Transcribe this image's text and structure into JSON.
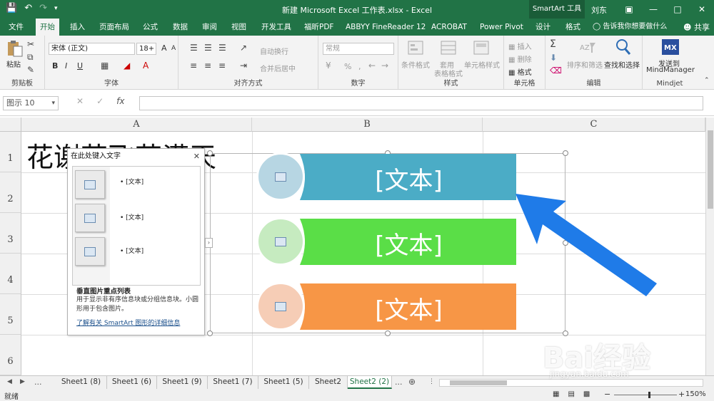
{
  "titlebar": {
    "title": "新建 Microsoft Excel 工作表.xlsx  -  Excel",
    "context_tab": "SmartArt 工具",
    "user": "刘东",
    "qat": [
      "save-icon",
      "undo-icon",
      "redo-icon",
      "customize-icon"
    ]
  },
  "tabs": {
    "items": [
      "文件",
      "开始",
      "插入",
      "页面布局",
      "公式",
      "数据",
      "审阅",
      "视图",
      "开发工具",
      "福昕PDF",
      "ABBYY FineReader 12",
      "ACROBAT",
      "Power Pivot",
      "设计",
      "格式"
    ],
    "active": "开始",
    "tell_me": "告诉我你想要做什么",
    "share": "共享"
  },
  "ribbon": {
    "clipboard": {
      "paste": "粘贴",
      "label": "剪贴板"
    },
    "font": {
      "name": "宋体 (正文)",
      "size": "18+",
      "bold": "B",
      "italic": "I",
      "underline": "U",
      "grow": "A",
      "shrink": "A",
      "label": "字体"
    },
    "alignment": {
      "wrap": "自动换行",
      "merge": "合并后居中",
      "label": "对齐方式"
    },
    "number": {
      "format": "常规",
      "percent": "%",
      "comma": ",",
      "label": "数字"
    },
    "styles": {
      "conditional": "条件格式",
      "table": "套用\n表格格式",
      "cell": "单元格样式",
      "label": "样式"
    },
    "cells": {
      "insert": "插入",
      "delete": "删除",
      "format": "格式",
      "label": "单元格"
    },
    "editing": {
      "sort": "排序和筛选",
      "find": "查找和选择",
      "label": "编辑"
    },
    "mindjet": {
      "send": "发送到",
      "target": "MindManager",
      "label": "Mindjet"
    }
  },
  "formula_bar": {
    "name_box": "图示 10",
    "fx": "fx",
    "value": ""
  },
  "grid": {
    "columns": [
      "A",
      "B",
      "C"
    ],
    "rows": [
      "1",
      "2",
      "3",
      "4",
      "5",
      "6"
    ],
    "a1": "花谢花飞花满天"
  },
  "smartart": {
    "items": [
      {
        "text": "[文本]",
        "bar_color": "#4BACC6",
        "circle_color": "#B7D6E3"
      },
      {
        "text": "[文本]",
        "bar_color": "#5ADE47",
        "circle_color": "#C6EBC0"
      },
      {
        "text": "[文本]",
        "bar_color": "#F79646",
        "circle_color": "#F6CDB6"
      }
    ],
    "arrow_color": "#1F7BE8"
  },
  "text_pane": {
    "title": "在此处键入文字",
    "bullets": [
      "[文本]",
      "[文本]",
      "[文本]"
    ],
    "layout_name": "垂直图片重点列表",
    "description": "用于显示非有序信息块或分组信息块。小圆形用于包含图片。",
    "link": "了解有关 SmartArt 图形的详细信息"
  },
  "sheets": {
    "tabs": [
      "Sheet1 (8)",
      "Sheet1 (6)",
      "Sheet1 (9)",
      "Sheet1 (7)",
      "Sheet1 (5)",
      "Sheet2",
      "Sheet2 (2)"
    ],
    "active": "Sheet2 (2)",
    "ellipsis": "..."
  },
  "status": {
    "text": "就绪",
    "zoom": "150%"
  },
  "watermark": {
    "brand": "Bai经验",
    "url": "jingyan.baidu.com"
  }
}
